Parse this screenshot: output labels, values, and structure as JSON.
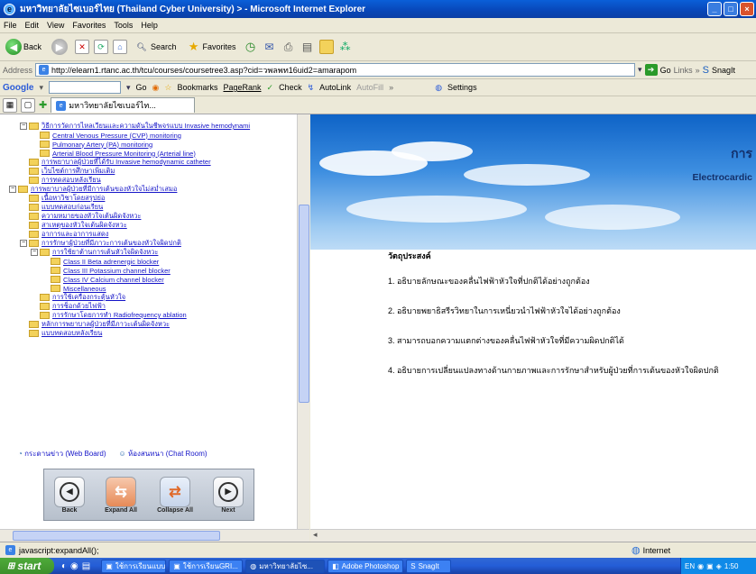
{
  "window": {
    "title": "มหาวิทยาลัยไซเบอร์ไทย (Thailand Cyber University) > - Microsoft Internet Explorer"
  },
  "menu": [
    "File",
    "Edit",
    "View",
    "Favorites",
    "Tools",
    "Help"
  ],
  "toolbar": {
    "back": "Back",
    "search": "Search",
    "favorites": "Favorites"
  },
  "address": {
    "label": "Address",
    "url": "http://elearn1.rtanc.ac.th/tcu/courses/coursetree3.asp?cid=วพลพท16uid2=amarapom",
    "go": "Go",
    "links": "Links",
    "snagit": "SnagIt"
  },
  "googlebar": {
    "logo": "Google",
    "go": "Go",
    "bookmarks": "Bookmarks",
    "pagerank": "PageRank",
    "check": "Check",
    "autolink": "AutoLink",
    "autofill": "AutoFill",
    "settings": "Settings"
  },
  "tabs": [
    {
      "label": "มหาวิทยาลัยไซเบอร์ไท..."
    }
  ],
  "tree": [
    {
      "level": 1,
      "type": "folder-open",
      "label": "วิธีการวัดการไหลเวียนและความดันในชีพจรแบบ Invasive hemodynami"
    },
    {
      "level": 2,
      "type": "item",
      "label": "Central Venous Pressure (CVP) monitoring"
    },
    {
      "level": 2,
      "type": "item",
      "label": "Pulmonary Artery (PA) monitoring"
    },
    {
      "level": 2,
      "type": "item",
      "label": "Arterial Blood Pressure Monitoring (Arterial line)"
    },
    {
      "level": 1,
      "type": "item",
      "label": "การพยาบาลผู้ป่วยที่ได้รับ Invasive hemodynamic catheter"
    },
    {
      "level": 1,
      "type": "item",
      "label": "เว็บไซต์การศึกษาเพิ่มเติม"
    },
    {
      "level": 1,
      "type": "item",
      "label": "การทดสอบหลังเรียน"
    },
    {
      "level": 0,
      "type": "folder-open",
      "label": "การพยาบาลผู้ป่วยที่มีการเต้นของหัวใจไม่สม่ำเสมอ"
    },
    {
      "level": 1,
      "type": "item",
      "label": "เนื้อหาวิชาโดยสรุปย่อ"
    },
    {
      "level": 1,
      "type": "item",
      "label": "แบบทดสอบก่อนเรียน"
    },
    {
      "level": 1,
      "type": "item",
      "label": "ความหมายของหัวใจเต้นผิดจังหวะ"
    },
    {
      "level": 1,
      "type": "item",
      "label": "สาเหตุของหัวใจเต้นผิดจังหวะ"
    },
    {
      "level": 1,
      "type": "item",
      "label": "อาการและอาการแสดง"
    },
    {
      "level": 1,
      "type": "folder-open",
      "label": "การรักษาผู้ป่วยที่มีภาวะการเต้นของหัวใจผิดปกติ"
    },
    {
      "level": 2,
      "type": "folder-open",
      "label": "การใช้ยาต้านการเต้นหัวใจผิดจังหวะ"
    },
    {
      "level": 3,
      "type": "item",
      "label": "Class II Beta adrenergic blocker"
    },
    {
      "level": 3,
      "type": "item",
      "label": "Class III Potassium channel blocker"
    },
    {
      "level": 3,
      "type": "item",
      "label": "Class IV Calcium channel blocker"
    },
    {
      "level": 3,
      "type": "item",
      "label": "Miscellaneous"
    },
    {
      "level": 2,
      "type": "item",
      "label": "การใช้เครื่องกระตุ้นหัวใจ"
    },
    {
      "level": 2,
      "type": "item",
      "label": "การช็อกด้วยไฟฟ้า"
    },
    {
      "level": 2,
      "type": "item",
      "label": "การรักษาโดยการทำ Radiofrequency ablation"
    },
    {
      "level": 1,
      "type": "item",
      "label": "หลักการพยาบาลผู้ป่วยที่มีภาวะเต้นผิดจังหวะ"
    },
    {
      "level": 1,
      "type": "item",
      "label": "แบบทดสอบหลังเรียน"
    }
  ],
  "board": {
    "webboard": "กระดานข่าว (Web Board)",
    "chat": "ห้องสนทนา (Chat Room)"
  },
  "nav": {
    "back": "Back",
    "expand": "Expand All",
    "collapse": "Collapse All",
    "next": "Next"
  },
  "banner": {
    "line1": "การ",
    "line2": "Electrocardic"
  },
  "objectives": {
    "heading": "วัตถุประสงค์",
    "items": [
      "1. อธิบายลักษณะของคลื่นไฟฟ้าหัวใจที่ปกติได้อย่างถูกต้อง",
      "2. อธิบายพยาธิสรีรวิทยาในการเหนี่ยวนำไฟฟ้าหัวใจได้อย่างถูกต้อง",
      "3. สามารถบอกความแตกต่างของคลื่นไฟฟ้าหัวใจที่มีความผิดปกติได้",
      "4. อธิบายการเปลี่ยนแปลงทางด้านกายภาพและการรักษาสำหรับผู้ป่วยที่การเต้นของหัวใจผิดปกติ"
    ]
  },
  "status": {
    "text": "javascript:expandAll();",
    "zone": "Internet"
  },
  "taskbar": {
    "start": "start",
    "tasks": [
      "ใช้การเรียนแบบ...",
      "ใช้การเรียนGRI...",
      "มหาวิทยาลัยไซ...",
      "Adobe Photoshop",
      "SnagIt"
    ],
    "lang": "EN",
    "time": "1:50"
  },
  "colors": {
    "link": "#1414c8",
    "titlebar": "#0846b8",
    "banner_top": "#0e63c7"
  }
}
